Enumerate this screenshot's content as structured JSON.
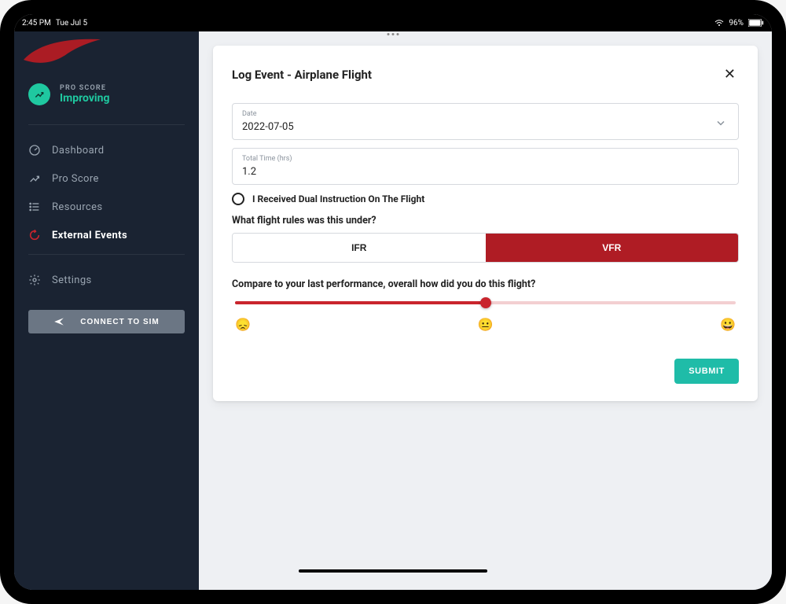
{
  "status": {
    "time": "2:45 PM",
    "date": "Tue Jul 5",
    "battery": "96%"
  },
  "sidebar": {
    "pro_score_label": "PRO SCORE",
    "pro_score_value": "Improving",
    "items": [
      {
        "label": "Dashboard"
      },
      {
        "label": "Pro Score"
      },
      {
        "label": "Resources"
      },
      {
        "label": "External Events"
      }
    ],
    "settings_label": "Settings",
    "connect_label": "CONNECT TO SIM"
  },
  "form": {
    "title": "Log Event - Airplane Flight",
    "date_label": "Date",
    "date_value": "2022-07-05",
    "time_label": "Total Time (hrs)",
    "time_value": "1.2",
    "dual_label": "I Received Dual Instruction On The Flight",
    "rules_question": "What flight rules was this under?",
    "ifr_label": "IFR",
    "vfr_label": "VFR",
    "compare_question": "Compare to your last performance, overall how did you do this flight?",
    "emoji_sad": "😞",
    "emoji_mid": "😐",
    "emoji_happy": "😀",
    "submit_label": "SUBMIT",
    "slider_value": 0.5,
    "selected_rule": "VFR"
  }
}
